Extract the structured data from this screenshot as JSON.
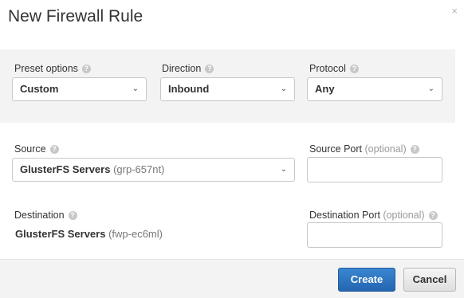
{
  "dialog": {
    "title": "New Firewall Rule",
    "close_label": "×"
  },
  "preset": {
    "label": "Preset options",
    "value": "Custom"
  },
  "direction": {
    "label": "Direction",
    "value": "Inbound"
  },
  "protocol": {
    "label": "Protocol",
    "value": "Any"
  },
  "source": {
    "label": "Source",
    "value": "GlusterFS Servers",
    "sub": "(grp-657nt)"
  },
  "source_port": {
    "label": "Source Port",
    "hint": "(optional)",
    "value": ""
  },
  "destination": {
    "label": "Destination",
    "value": "GlusterFS Servers",
    "sub": "(fwp-ec6ml)"
  },
  "destination_port": {
    "label": "Destination Port",
    "hint": "(optional)",
    "value": ""
  },
  "footer": {
    "create_label": "Create",
    "cancel_label": "Cancel"
  },
  "icons": {
    "help": "?",
    "chevron": "⌄"
  },
  "colors": {
    "primary": "#2a6fbd",
    "panel": "#f3f3f3"
  }
}
